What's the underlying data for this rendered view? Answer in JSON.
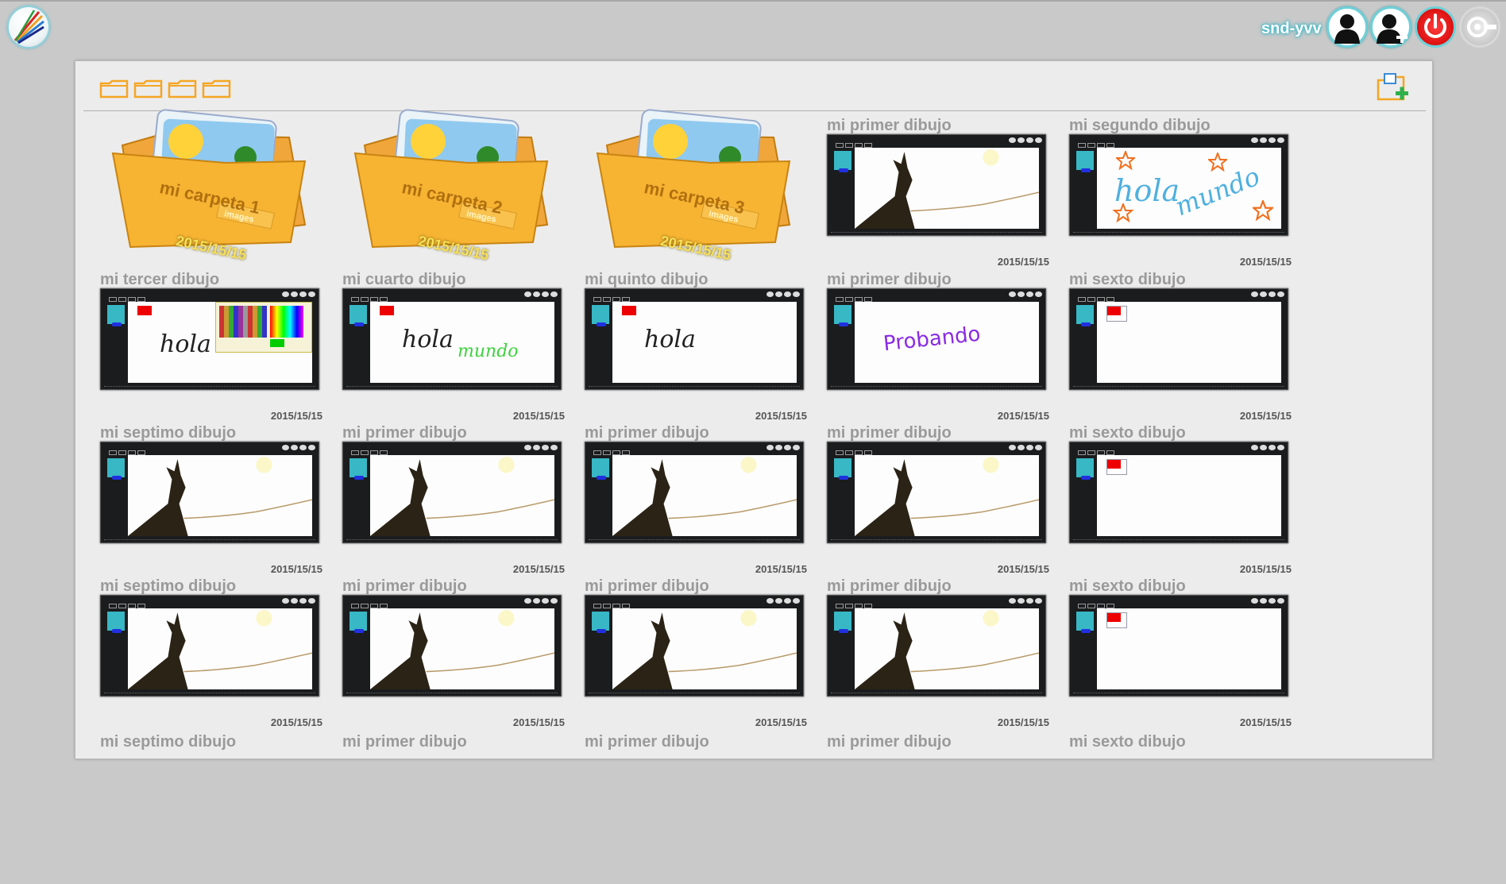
{
  "header": {
    "username": "snd-yvv",
    "buttons": [
      {
        "name": "profile-button",
        "icon": "user-silhouette-icon"
      },
      {
        "name": "add-user-button",
        "icon": "add-user-icon"
      },
      {
        "name": "logout-button",
        "icon": "power-icon"
      },
      {
        "name": "settings-button",
        "icon": "gear-icon"
      }
    ]
  },
  "toolbar": {
    "folder_tabs": 4,
    "new_folder_icon": "new-folder-icon"
  },
  "folders": [
    {
      "name": "mi carpeta 1",
      "label": "images",
      "date": "2015/15/15"
    },
    {
      "name": "mi carpeta 2",
      "label": "images",
      "date": "2015/15/15"
    },
    {
      "name": "mi carpeta 3",
      "label": "images",
      "date": "2015/15/15"
    }
  ],
  "drawings": [
    {
      "title": "mi primer dibujo",
      "date": "2015/15/15",
      "thumb": "tree"
    },
    {
      "title": "mi segundo dibujo",
      "date": "2015/15/15",
      "thumb": "hola-mundo-color"
    },
    {
      "title": "mi tercer dibujo",
      "date": "2015/15/15",
      "thumb": "hola-palette"
    },
    {
      "title": "mi cuarto dibujo",
      "date": "2015/15/15",
      "thumb": "hola-mundo"
    },
    {
      "title": "mi quinto dibujo",
      "date": "2015/15/15",
      "thumb": "hola"
    },
    {
      "title": "mi primer dibujo",
      "date": "2015/15/15",
      "thumb": "probando"
    },
    {
      "title": "mi sexto dibujo",
      "date": "2015/15/15",
      "thumb": "blank"
    },
    {
      "title": "mi septimo dibujo",
      "date": "2015/15/15",
      "thumb": "tree"
    },
    {
      "title": "mi primer dibujo",
      "date": "2015/15/15",
      "thumb": "tree"
    },
    {
      "title": "mi primer dibujo",
      "date": "2015/15/15",
      "thumb": "tree"
    },
    {
      "title": "mi primer dibujo",
      "date": "2015/15/15",
      "thumb": "tree"
    },
    {
      "title": "mi sexto dibujo",
      "date": "2015/15/15",
      "thumb": "blank"
    },
    {
      "title": "mi septimo dibujo",
      "date": "2015/15/15",
      "thumb": "tree"
    },
    {
      "title": "mi primer dibujo",
      "date": "2015/15/15",
      "thumb": "tree"
    },
    {
      "title": "mi primer dibujo",
      "date": "2015/15/15",
      "thumb": "tree"
    },
    {
      "title": "mi primer dibujo",
      "date": "2015/15/15",
      "thumb": "tree"
    },
    {
      "title": "mi sexto dibujo",
      "date": "2015/15/15",
      "thumb": "blank"
    },
    {
      "title": "mi septimo dibujo",
      "date": "",
      "thumb": "none"
    },
    {
      "title": "mi primer dibujo",
      "date": "",
      "thumb": "none"
    },
    {
      "title": "mi primer dibujo",
      "date": "",
      "thumb": "none"
    },
    {
      "title": "mi primer dibujo",
      "date": "",
      "thumb": "none"
    },
    {
      "title": "mi sexto dibujo",
      "date": "",
      "thumb": "none"
    }
  ],
  "thumb_texts": {
    "hola": "hola",
    "mundo": "mundo",
    "probando": "Probando"
  },
  "colors": {
    "accent": "#3db8c9",
    "folder": "#f5a623",
    "power": "#e01010",
    "title": "#9a9a9a"
  }
}
